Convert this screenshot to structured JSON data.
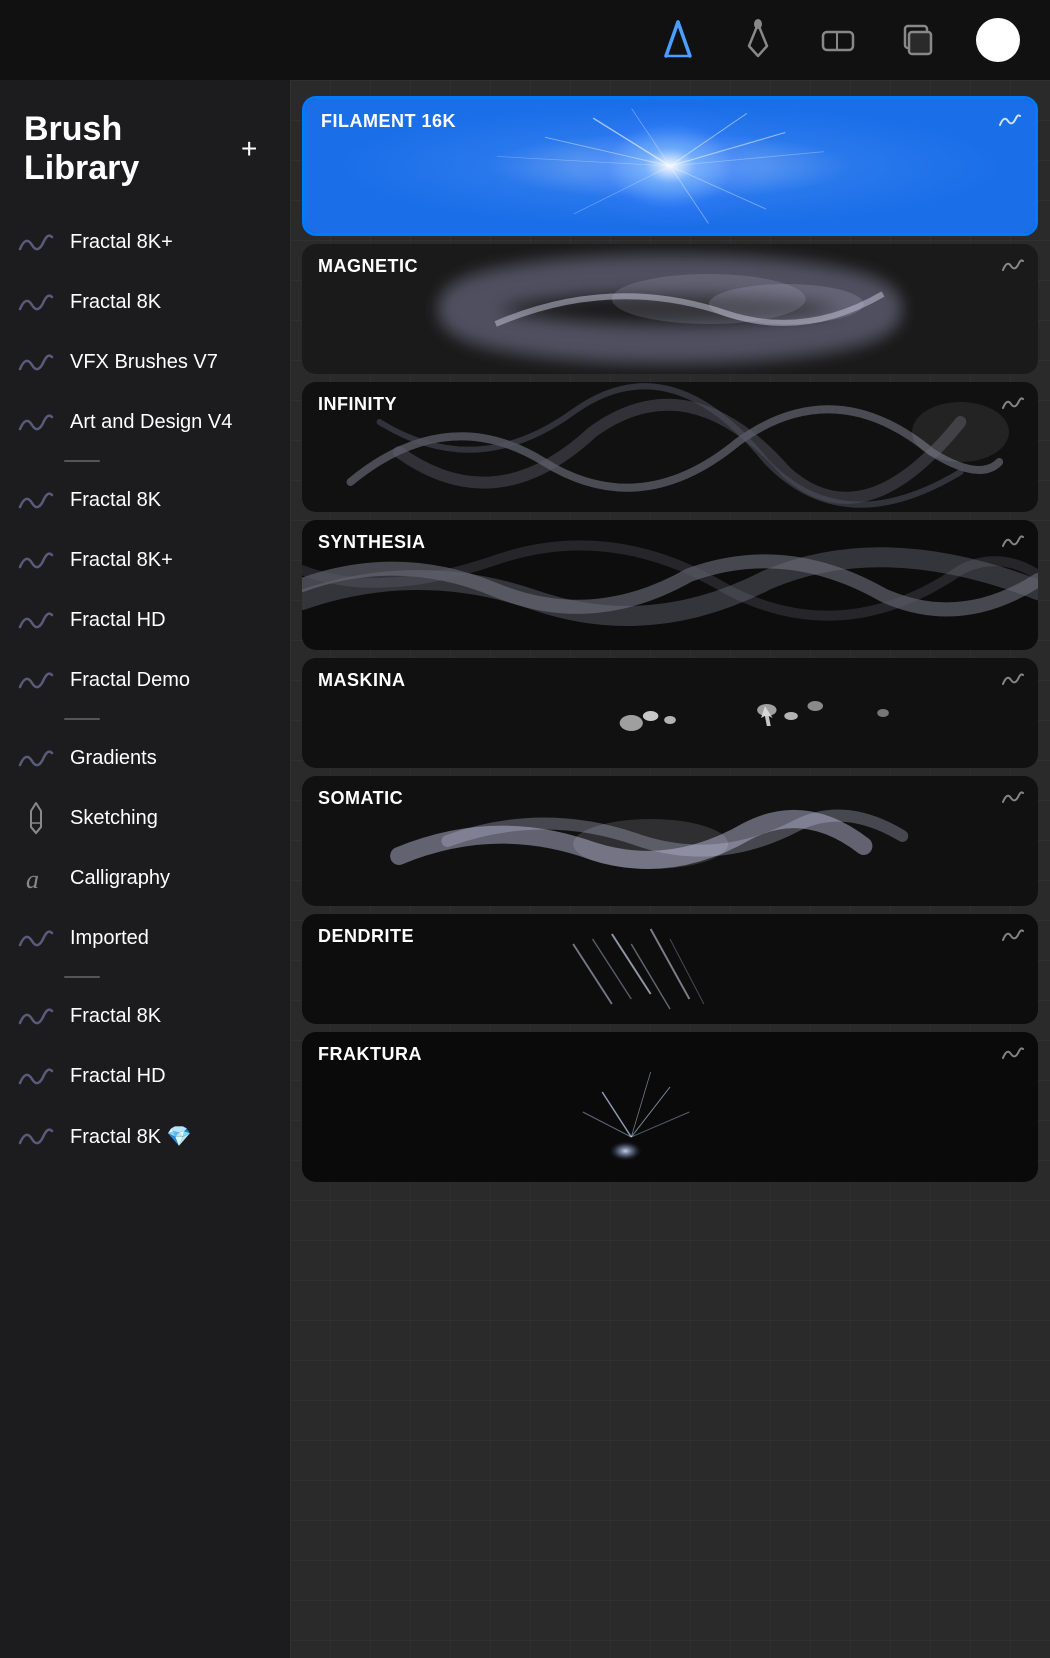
{
  "app": {
    "title": "Brush Library"
  },
  "toolbar": {
    "icons": [
      "pencil",
      "pen",
      "eraser",
      "layers",
      "color"
    ]
  },
  "header": {
    "title": "Brush Library",
    "add_label": "+"
  },
  "sidebar": {
    "items": [
      {
        "id": "fractal8kplus-1",
        "label": "Fractal 8K+",
        "icon": "brush-wave",
        "type": "item"
      },
      {
        "id": "fractal8k-1",
        "label": "Fractal 8K",
        "icon": "brush-wave",
        "type": "item"
      },
      {
        "id": "vfx-brushes",
        "label": "VFX Brushes V7",
        "icon": "brush-wave",
        "type": "item"
      },
      {
        "id": "art-design",
        "label": "Art and Design V4",
        "icon": "brush-wave",
        "type": "item"
      },
      {
        "id": "divider-1",
        "type": "divider"
      },
      {
        "id": "fractal8k-2",
        "label": "Fractal 8K",
        "icon": "brush-wave",
        "type": "item"
      },
      {
        "id": "fractal8kplus-2",
        "label": "Fractal 8K+",
        "icon": "brush-wave",
        "type": "item"
      },
      {
        "id": "fractal-hd",
        "label": "Fractal HD",
        "icon": "brush-wave",
        "type": "item"
      },
      {
        "id": "fractal-demo",
        "label": "Fractal Demo",
        "icon": "brush-wave",
        "type": "item"
      },
      {
        "id": "divider-2",
        "type": "divider"
      },
      {
        "id": "gradients",
        "label": "Gradients",
        "icon": "brush-wave",
        "type": "item"
      },
      {
        "id": "sketching",
        "label": "Sketching",
        "icon": "pencil-tip",
        "type": "item"
      },
      {
        "id": "calligraphy",
        "label": "Calligraphy",
        "icon": "italic-a",
        "type": "item"
      },
      {
        "id": "imported",
        "label": "Imported",
        "icon": "brush-wave",
        "type": "item"
      },
      {
        "id": "divider-3",
        "type": "divider"
      },
      {
        "id": "fractal8k-3",
        "label": "Fractal 8K",
        "icon": "brush-wave",
        "type": "item"
      },
      {
        "id": "fractal-hd-2",
        "label": "Fractal HD",
        "icon": "brush-wave",
        "type": "item"
      },
      {
        "id": "fractal8k-gem",
        "label": "Fractal 8K 💎",
        "icon": "brush-wave",
        "type": "item"
      }
    ]
  },
  "brushes": [
    {
      "id": "filament",
      "label": "FILAMENT 16K",
      "selected": true,
      "style": "filament"
    },
    {
      "id": "magnetic",
      "label": "MAGNETIC",
      "selected": false,
      "style": "magnetic"
    },
    {
      "id": "infinity",
      "label": "INFINITY",
      "selected": false,
      "style": "infinity"
    },
    {
      "id": "synthesia",
      "label": "SYNTHESIA",
      "selected": false,
      "style": "synthesia"
    },
    {
      "id": "maskina",
      "label": "MASKINA",
      "selected": false,
      "style": "maskina"
    },
    {
      "id": "somatic",
      "label": "SOMATIC",
      "selected": false,
      "style": "somatic"
    },
    {
      "id": "dendrite",
      "label": "DENDRITE",
      "selected": false,
      "style": "dendrite"
    },
    {
      "id": "fraktura",
      "label": "FRAKTURA",
      "selected": false,
      "style": "fraktura"
    }
  ]
}
